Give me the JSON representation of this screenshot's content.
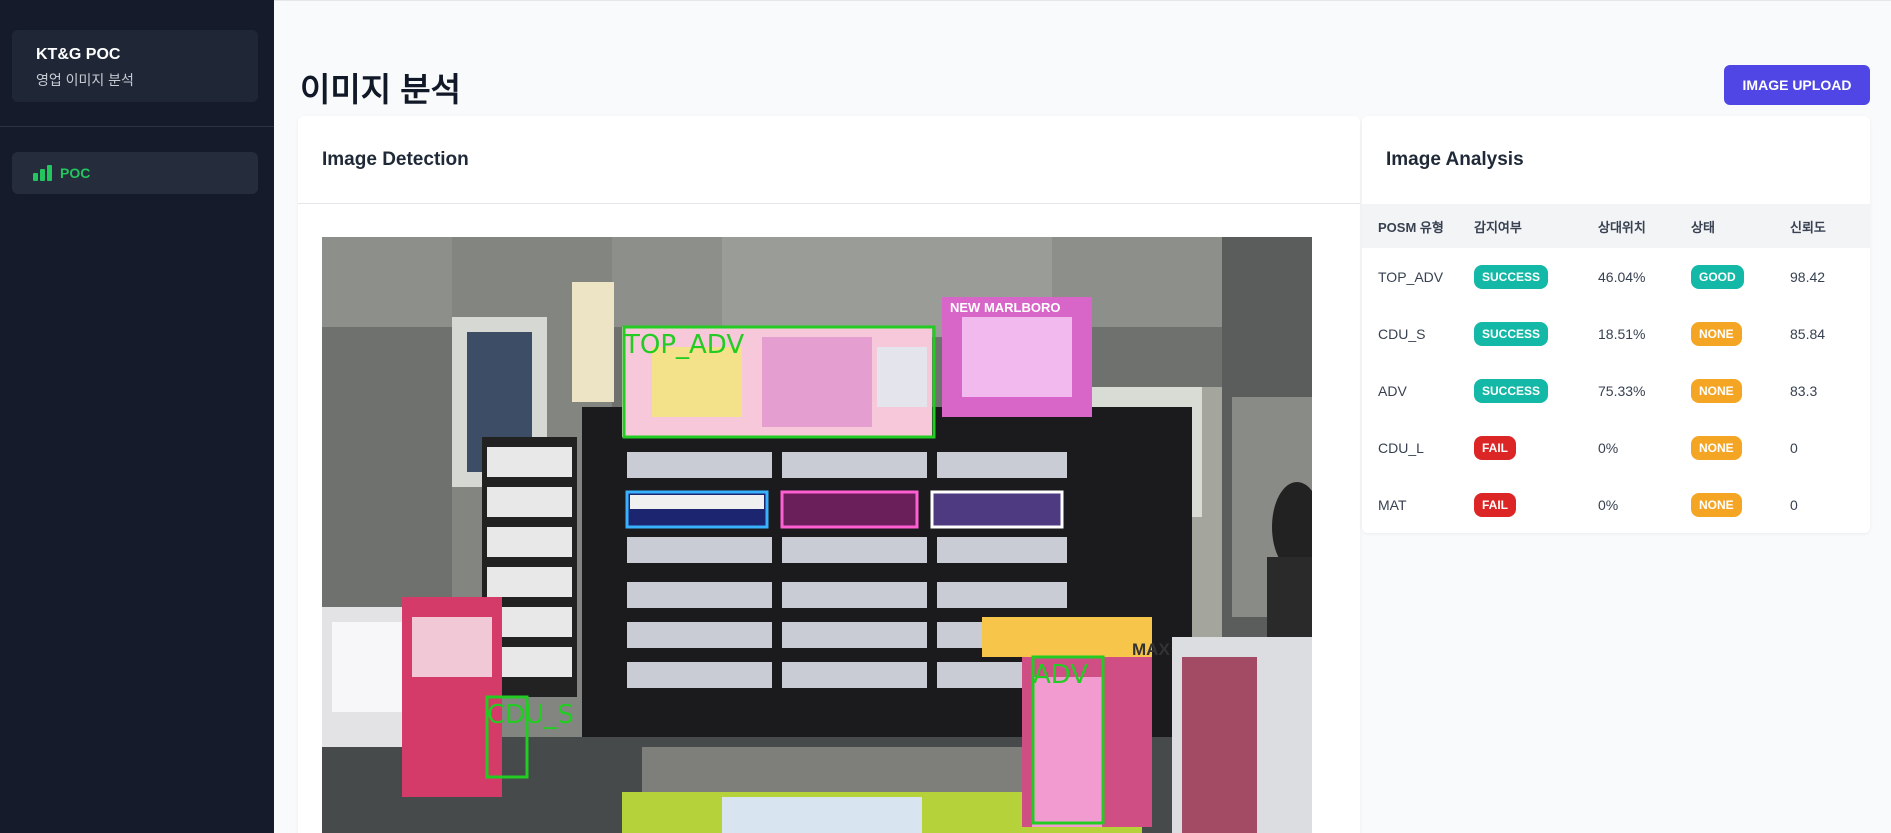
{
  "sidebar": {
    "brand_title": "KT&G POC",
    "brand_subtitle": "영업 이미지 분석",
    "nav": [
      {
        "label": "POC",
        "icon": "bar-chart-icon",
        "active": true
      }
    ]
  },
  "header": {
    "title": "이미지 분석",
    "upload_label": "IMAGE UPLOAD"
  },
  "detection": {
    "title": "Image Detection",
    "boxes": [
      {
        "label": "TOP_ADV"
      },
      {
        "label": "CDU_S"
      },
      {
        "label": "ADV"
      }
    ],
    "store_signs": [
      "NEW MARLBORO",
      "MAX"
    ]
  },
  "analysis": {
    "title": "Image Analysis",
    "columns": [
      "POSM 유형",
      "감지여부",
      "상대위치",
      "상태",
      "신뢰도"
    ],
    "rows": [
      {
        "type": "TOP_ADV",
        "detected": "SUCCESS",
        "position": "46.04%",
        "status": "GOOD",
        "confidence": "98.42"
      },
      {
        "type": "CDU_S",
        "detected": "SUCCESS",
        "position": "18.51%",
        "status": "NONE",
        "confidence": "85.84"
      },
      {
        "type": "ADV",
        "detected": "SUCCESS",
        "position": "75.33%",
        "status": "NONE",
        "confidence": "83.3"
      },
      {
        "type": "CDU_L",
        "detected": "FAIL",
        "position": "0%",
        "status": "NONE",
        "confidence": "0"
      },
      {
        "type": "MAT",
        "detected": "FAIL",
        "position": "0%",
        "status": "NONE",
        "confidence": "0"
      }
    ]
  },
  "colors": {
    "sidebar_bg": "#151b2b",
    "accent": "#4f46e5",
    "nav_active": "#22c55e",
    "success": "#14b8a6",
    "fail": "#dc2626",
    "none": "#f5a524",
    "detection_box": "#22cc22"
  }
}
